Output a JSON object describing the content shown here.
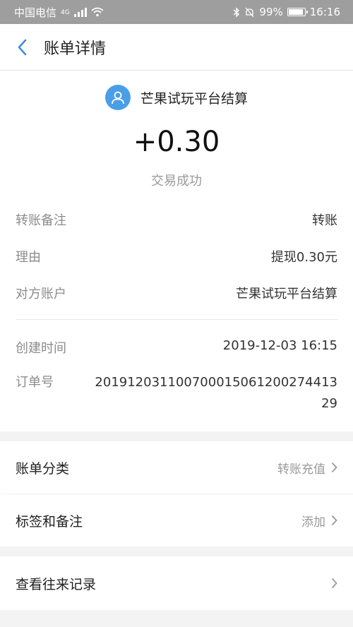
{
  "status_bar": {
    "carrier": "中国电信",
    "network": "4G",
    "battery": "99%",
    "time": "16:16"
  },
  "nav": {
    "title": "账单详情",
    "back_icon": "chevron-left-icon"
  },
  "summary": {
    "payee": "芒果试玩平台结算",
    "amount": "+0.30",
    "status": "交易成功"
  },
  "details": [
    {
      "label": "转账备注",
      "value": "转账"
    },
    {
      "label": "理由",
      "value": "提现0.30元"
    },
    {
      "label": "对方账户",
      "value": "芒果试玩平台结算"
    }
  ],
  "details2": [
    {
      "label": "创建时间",
      "value": "2019-12-03 16:15"
    },
    {
      "label": "订单号",
      "value": "20191203110070001506120027441329"
    }
  ],
  "menu": [
    {
      "label": "账单分类",
      "value": "转账充值"
    },
    {
      "label": "标签和备注",
      "value": "添加"
    },
    {
      "label": "查看往来记录",
      "value": ""
    }
  ],
  "colors": {
    "accent": "#4a9ee8",
    "status_bar": "#9e9e9e"
  }
}
